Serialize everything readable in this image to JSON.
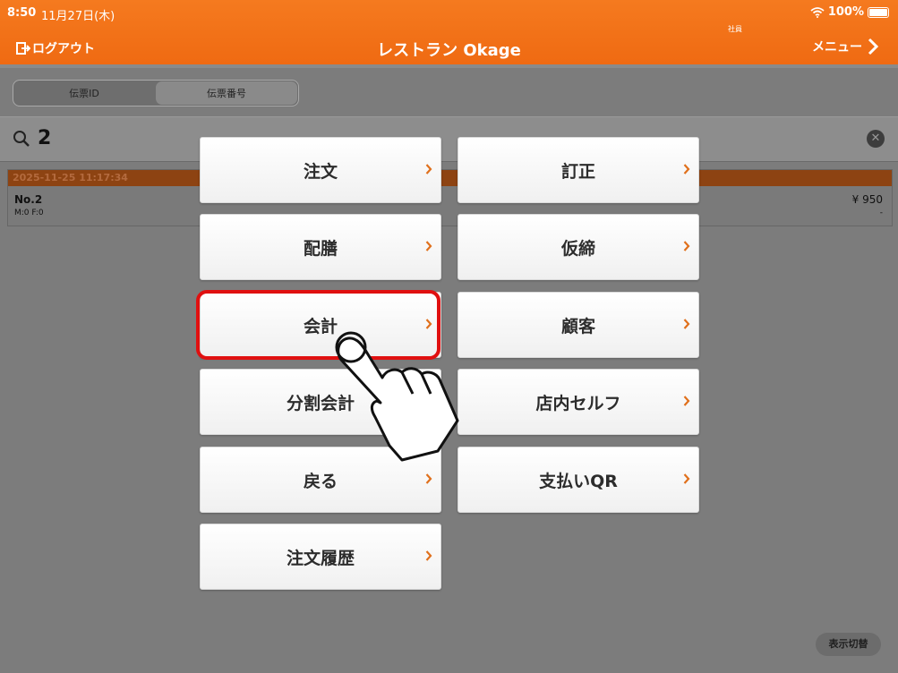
{
  "status_bar": {
    "time": "8:50",
    "date": "11月27日(木)",
    "battery": "100%"
  },
  "header": {
    "logout_label": "ログアウト",
    "title": "レストラン Okage",
    "role": "社員",
    "menu_label": "メニュー"
  },
  "segmented": {
    "items": [
      "伝票ID",
      "伝票番号"
    ],
    "selected": "伝票番号"
  },
  "search": {
    "value": "2"
  },
  "result": {
    "timestamp": "2025-11-25 11:17:34",
    "number": "No.2",
    "mf": "M:0 F:0",
    "price": "¥ 950",
    "note": "-"
  },
  "actions": {
    "order": "注文",
    "correction": "訂正",
    "serving": "配膳",
    "provisional": "仮締",
    "checkout": "会計",
    "customer": "顧客",
    "split_checkout": "分割会計",
    "self_order": "店内セルフ",
    "back": "戻る",
    "qr_pay": "支払いQR",
    "order_history": "注文履歴"
  },
  "footer": {
    "toggle_label": "表示切替"
  },
  "colors": {
    "header": "#f57a1f",
    "highlight": "#e01010",
    "chevron": "#e0701c"
  }
}
